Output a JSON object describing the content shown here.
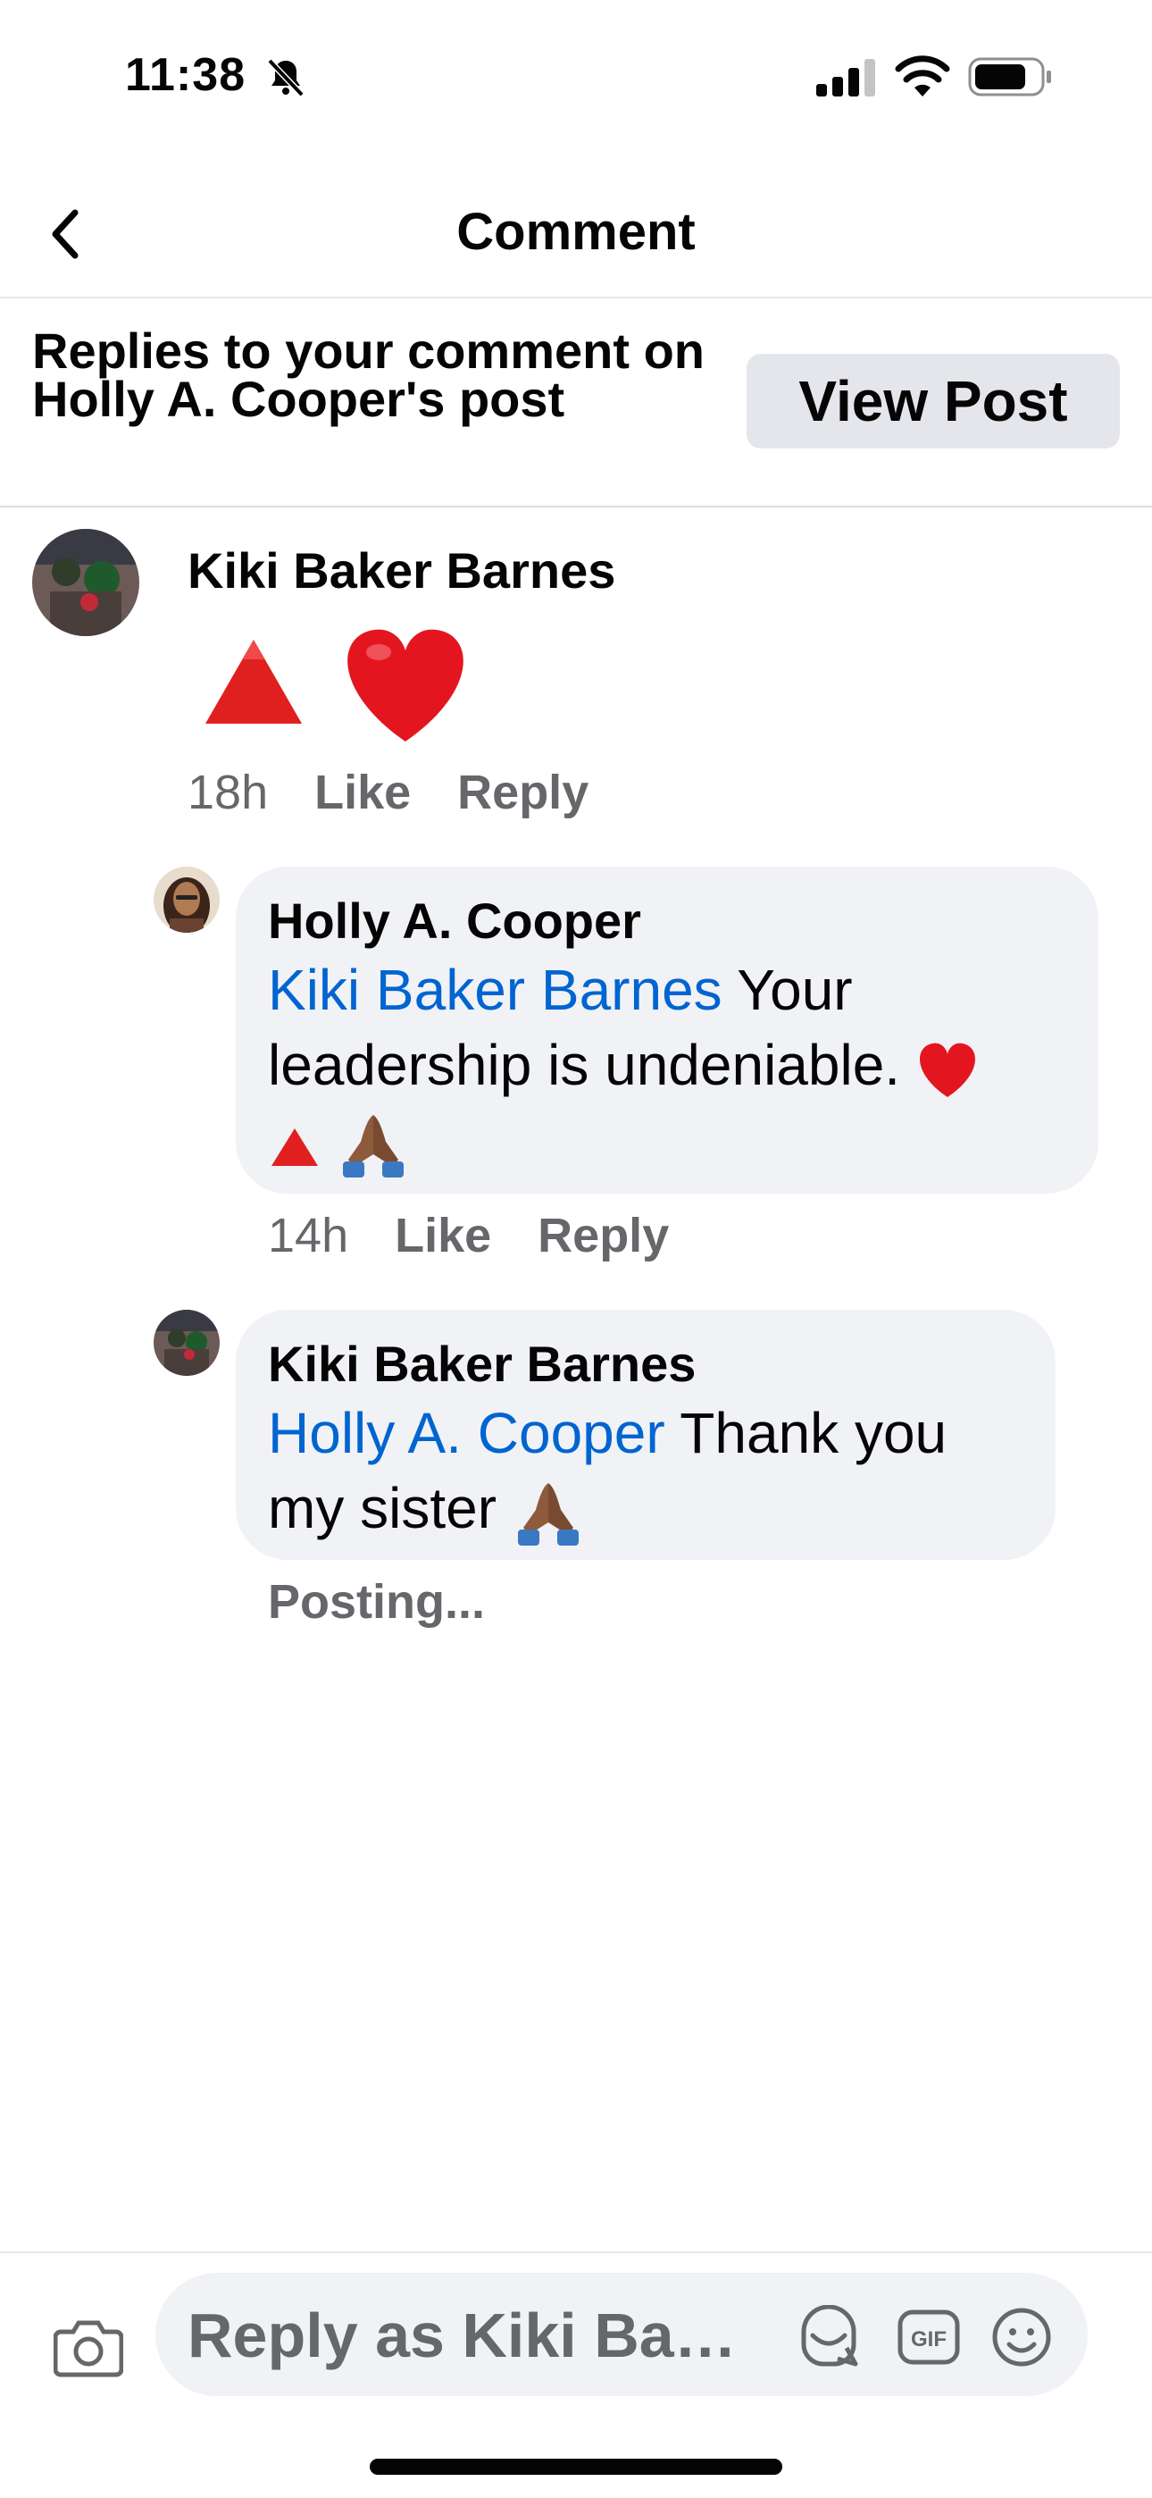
{
  "status_bar": {
    "time": "11:38",
    "icons": [
      "bell-slash-icon",
      "cell-signal-icon",
      "wifi-icon",
      "battery-icon"
    ]
  },
  "header": {
    "title": "Comment",
    "back_icon": "chevron-left-icon"
  },
  "banner": {
    "prefix": "Replies to your comment on ",
    "post_owner": "Holly A. Cooper",
    "suffix": "'s post",
    "button_label": "View Post"
  },
  "comments": [
    {
      "author": "Kiki Baker Barnes",
      "content_emojis": [
        "red-triangle-icon",
        "red-heart-icon"
      ],
      "time": "18h",
      "like_label": "Like",
      "reply_label": "Reply"
    }
  ],
  "replies": [
    {
      "author": "Holly A. Cooper",
      "mention": "Kiki Baker Barnes",
      "text": " Your leadership is undeniable. ",
      "emojis": [
        "red-heart-icon",
        "red-triangle-icon",
        "folded-hands-icon"
      ],
      "time": "14h",
      "like_label": "Like",
      "reply_label": "Reply"
    },
    {
      "author": "Kiki Baker Barnes",
      "mention": "Holly A. Cooper",
      "text": " Thank you my sister ",
      "emojis": [
        "folded-hands-icon"
      ],
      "status": "Posting..."
    }
  ],
  "composer": {
    "placeholder": "Reply as Kiki Bake...",
    "icons": [
      "camera-icon",
      "sticker-icon",
      "gif-icon",
      "smiley-icon"
    ]
  },
  "colors": {
    "mention": "#0064d1",
    "muted": "#65676b",
    "bubble": "#f0f2f5",
    "button": "#e4e6eb"
  }
}
